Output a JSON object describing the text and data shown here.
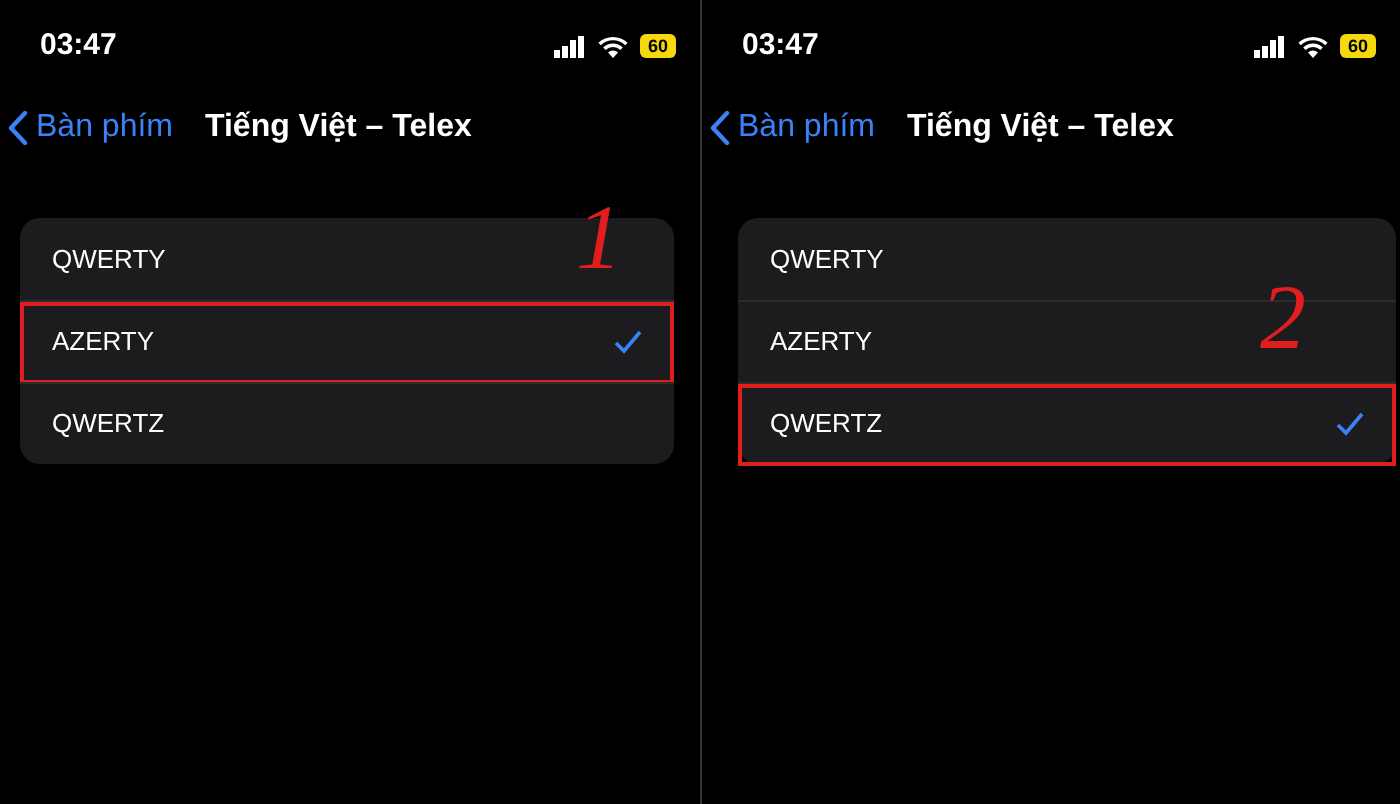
{
  "panels": [
    {
      "status_bar": {
        "time": "03:47",
        "battery": "60"
      },
      "nav": {
        "back": "Bàn phím",
        "title": "Tiếng Việt – Telex"
      },
      "layouts": [
        {
          "label": "QWERTY",
          "selected": false
        },
        {
          "label": "AZERTY",
          "selected": true
        },
        {
          "label": "QWERTZ",
          "selected": false
        }
      ],
      "annotation": "1"
    },
    {
      "status_bar": {
        "time": "03:47",
        "battery": "60"
      },
      "nav": {
        "back": "Bàn phím",
        "title": "Tiếng Việt – Telex"
      },
      "layouts": [
        {
          "label": "QWERTY",
          "selected": false
        },
        {
          "label": "AZERTY",
          "selected": false
        },
        {
          "label": "QWERTZ",
          "selected": true
        }
      ],
      "annotation": "2"
    }
  ]
}
